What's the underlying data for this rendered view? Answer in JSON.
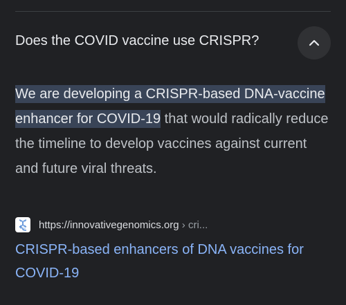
{
  "accordion": {
    "question": "Does the COVID vaccine use CRISPR?",
    "toggle_icon": "chevron-up-icon"
  },
  "answer": {
    "highlighted": "We are developing a CRISPR-based DNA-vaccine enhancer for COVID-19",
    "rest": " that would radically reduce the timeline to develop vaccines against current and future viral threats."
  },
  "source": {
    "favicon": "innovative-genomics-logo",
    "url": "https://innovativegenomics.org",
    "breadcrumb": " › cri...",
    "title": "CRISPR-based enhancers of DNA vaccines for COVID-19"
  },
  "colors": {
    "background": "#202124",
    "highlight": "#394457",
    "link": "#8ab4f8"
  }
}
